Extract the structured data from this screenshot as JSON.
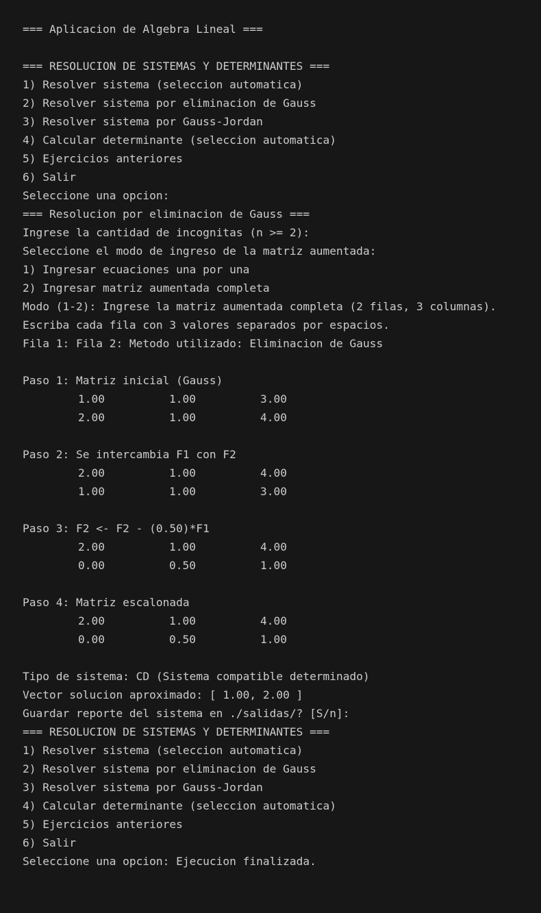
{
  "lines": [
    "=== Aplicacion de Algebra Lineal ===",
    "",
    "=== RESOLUCION DE SISTEMAS Y DETERMINANTES ===",
    "1) Resolver sistema (seleccion automatica)",
    "2) Resolver sistema por eliminacion de Gauss",
    "3) Resolver sistema por Gauss-Jordan",
    "4) Calcular determinante (seleccion automatica)",
    "5) Ejercicios anteriores",
    "6) Salir",
    "Seleccione una opcion:",
    "=== Resolucion por eliminacion de Gauss ===",
    "Ingrese la cantidad de incognitas (n >= 2):",
    "Seleccione el modo de ingreso de la matriz aumentada:",
    "1) Ingresar ecuaciones una por una",
    "2) Ingresar matriz aumentada completa",
    "Modo (1-2): Ingrese la matriz aumentada completa (2 filas, 3 columnas).",
    "Escriba cada fila con 3 valores separados por espacios.",
    "Fila 1: Fila 2: Metodo utilizado: Eliminacion de Gauss",
    "",
    "Paso 1: Matriz inicial (Gauss)",
    [
      "1.00",
      "1.00",
      "3.00"
    ],
    [
      "2.00",
      "1.00",
      "4.00"
    ],
    "",
    "Paso 2: Se intercambia F1 con F2",
    [
      "2.00",
      "1.00",
      "4.00"
    ],
    [
      "1.00",
      "1.00",
      "3.00"
    ],
    "",
    "Paso 3: F2 <- F2 - (0.50)*F1",
    [
      "2.00",
      "1.00",
      "4.00"
    ],
    [
      "0.00",
      "0.50",
      "1.00"
    ],
    "",
    "Paso 4: Matriz escalonada",
    [
      "2.00",
      "1.00",
      "4.00"
    ],
    [
      "0.00",
      "0.50",
      "1.00"
    ],
    "",
    "Tipo de sistema: CD (Sistema compatible determinado)",
    "Vector solucion aproximado: [ 1.00, 2.00 ]",
    "Guardar reporte del sistema en ./salidas/? [S/n]:",
    "=== RESOLUCION DE SISTEMAS Y DETERMINANTES ===",
    "1) Resolver sistema (seleccion automatica)",
    "2) Resolver sistema por eliminacion de Gauss",
    "3) Resolver sistema por Gauss-Jordan",
    "4) Calcular determinante (seleccion automatica)",
    "5) Ejercicios anteriores",
    "6) Salir",
    "Seleccione una opcion: Ejecucion finalizada."
  ]
}
